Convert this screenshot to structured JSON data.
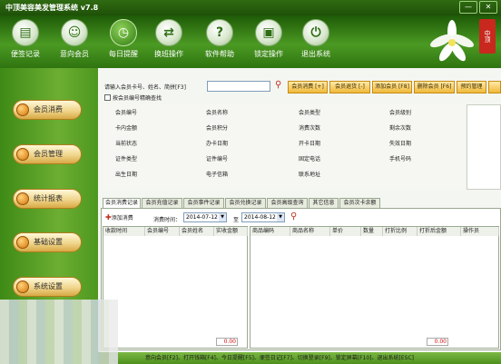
{
  "window": {
    "title": "中顶美容美发管理系统 v7.8",
    "min_label": "—",
    "close_label": "✕"
  },
  "toolbar": {
    "items": [
      {
        "label": "便签记录",
        "icon": "note-icon"
      },
      {
        "label": "意向会员",
        "icon": "person-icon"
      },
      {
        "label": "每日提醒",
        "icon": "alarm-clock-icon"
      },
      {
        "label": "换班操作",
        "icon": "swap-arrows-icon"
      },
      {
        "label": "软件帮助",
        "icon": "help-icon"
      },
      {
        "label": "锁定操作",
        "icon": "lock-icon"
      },
      {
        "label": "退出系统",
        "icon": "power-icon"
      }
    ],
    "seal_text": "中顶"
  },
  "sidebar": {
    "items": [
      {
        "label": "会员消费"
      },
      {
        "label": "会员管理"
      },
      {
        "label": "统计报表"
      },
      {
        "label": "基础设置"
      },
      {
        "label": "系统设置"
      }
    ]
  },
  "search": {
    "label": "请输入会员卡号、姓名、简拼[F3]",
    "value": "",
    "exact_checkbox_label": "按会员编号精确查找"
  },
  "actions": [
    {
      "label": "会员消费 [+]"
    },
    {
      "label": "会员退货 [-]"
    },
    {
      "label": "添加会员 [F8]"
    },
    {
      "label": "删除会员 [F6]"
    },
    {
      "label": "预约管理"
    }
  ],
  "member_fields": [
    [
      "会员编号",
      "会员名称",
      "会员类型",
      "会员级别"
    ],
    [
      "卡内金额",
      "会员积分",
      "消费次数",
      "剩余次数"
    ],
    [
      "当前状态",
      "办卡日期",
      "开卡日期",
      "失效日期"
    ],
    [
      "证件类型",
      "证件编号",
      "固定电话",
      "手机号码"
    ],
    [
      "出生日期",
      "电子信箱",
      "联系地址",
      ""
    ]
  ],
  "tabs": [
    {
      "label": "会员消费记录",
      "active": true
    },
    {
      "label": "会员充值记录",
      "active": false
    },
    {
      "label": "会员事件记录",
      "active": false
    },
    {
      "label": "会员兑换记录",
      "active": false
    },
    {
      "label": "会员高级查询",
      "active": false
    },
    {
      "label": "其它信息",
      "active": false
    },
    {
      "label": "会员次卡余额",
      "active": false
    }
  ],
  "filter": {
    "add_label": "添加消费",
    "date_label": "消费时间：",
    "start_date": "2014-07-12",
    "to_label": "至",
    "end_date": "2014-08-12"
  },
  "left_grid": {
    "columns": [
      "收款时间",
      "会员编号",
      "会员姓名",
      "实收金额"
    ],
    "total": "0.00"
  },
  "right_grid": {
    "columns": [
      "商品编码",
      "商品名称",
      "单价",
      "数量",
      "打折比例",
      "打折后金额",
      "操作员"
    ],
    "total": "0.00"
  },
  "statusbar": {
    "text": "意向会员[F2]、打开钱箱[F4]、今日提醒[F5]、便签日记[F7]、切换登录[F9]、锁定屏幕[F10]、退出系统[ESC]"
  }
}
